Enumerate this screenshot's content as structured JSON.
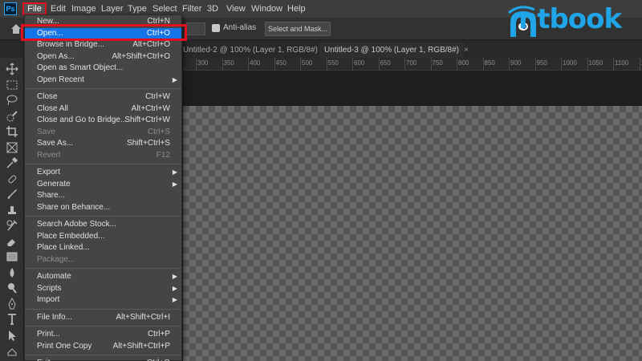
{
  "app": {
    "logo_text": "Ps"
  },
  "menubar": {
    "items": [
      "File",
      "Edit",
      "Image",
      "Layer",
      "Type",
      "Select",
      "Filter",
      "3D",
      "View",
      "Window",
      "Help"
    ]
  },
  "options_bar": {
    "anti_alias_label": "Anti-alias",
    "select_mask_label": "Select and Mask..."
  },
  "tabs": [
    {
      "label": "Untitled-2 @ 100% (Layer 1, RGB/8#)",
      "active": false
    },
    {
      "label": "Untitled-3 @ 100% (Layer 1, RGB/8#)",
      "active": true,
      "close": "×"
    }
  ],
  "ruler": {
    "ticks": [
      "300",
      "350",
      "400",
      "450",
      "500",
      "550",
      "600",
      "650",
      "700",
      "750",
      "800",
      "850",
      "900",
      "950",
      "1000",
      "1050",
      "1100",
      "1150"
    ]
  },
  "file_menu": {
    "items": [
      {
        "label": "New...",
        "shortcut": "Ctrl+N"
      },
      {
        "label": "Open...",
        "shortcut": "Ctrl+O",
        "highlighted": true
      },
      {
        "label": "Browse in Bridge...",
        "shortcut": "Alt+Ctrl+O"
      },
      {
        "label": "Open As...",
        "shortcut": "Alt+Shift+Ctrl+O"
      },
      {
        "label": "Open as Smart Object...",
        "shortcut": ""
      },
      {
        "label": "Open Recent",
        "submenu": true
      },
      {
        "label": "Close",
        "shortcut": "Ctrl+W"
      },
      {
        "label": "Close All",
        "shortcut": "Alt+Ctrl+W"
      },
      {
        "label": "Close and Go to Bridge...",
        "shortcut": "Shift+Ctrl+W"
      },
      {
        "label": "Save",
        "shortcut": "Ctrl+S",
        "disabled": true
      },
      {
        "label": "Save As...",
        "shortcut": "Shift+Ctrl+S"
      },
      {
        "label": "Revert",
        "shortcut": "F12",
        "disabled": true
      },
      {
        "label": "Export",
        "submenu": true
      },
      {
        "label": "Generate",
        "submenu": true
      },
      {
        "label": "Share...",
        "shortcut": ""
      },
      {
        "label": "Share on Behance...",
        "shortcut": ""
      },
      {
        "label": "Search Adobe Stock...",
        "shortcut": ""
      },
      {
        "label": "Place Embedded...",
        "shortcut": ""
      },
      {
        "label": "Place Linked...",
        "shortcut": ""
      },
      {
        "label": "Package...",
        "shortcut": "",
        "disabled": true
      },
      {
        "label": "Automate",
        "submenu": true
      },
      {
        "label": "Scripts",
        "submenu": true
      },
      {
        "label": "Import",
        "submenu": true
      },
      {
        "label": "File Info...",
        "shortcut": "Alt+Shift+Ctrl+I"
      },
      {
        "label": "Print...",
        "shortcut": "Ctrl+P"
      },
      {
        "label": "Print One Copy",
        "shortcut": "Alt+Shift+Ctrl+P"
      },
      {
        "label": "Exit",
        "shortcut": "Ctrl+Q"
      }
    ]
  },
  "watermark": {
    "text": "ntbook"
  },
  "colors": {
    "accent": "#1473e6",
    "annotation": "#e01020",
    "watermark": "#1fa5e8"
  },
  "toolbar_icons": [
    "move-icon",
    "marquee-icon",
    "lasso-icon",
    "quick-select-icon",
    "crop-icon",
    "frame-icon",
    "eyedropper-icon",
    "healing-brush-icon",
    "brush-icon",
    "clone-stamp-icon",
    "history-brush-icon",
    "eraser-icon",
    "gradient-icon",
    "blur-icon",
    "dodge-icon",
    "pen-icon",
    "type-icon",
    "path-select-icon",
    "shape-icon"
  ]
}
